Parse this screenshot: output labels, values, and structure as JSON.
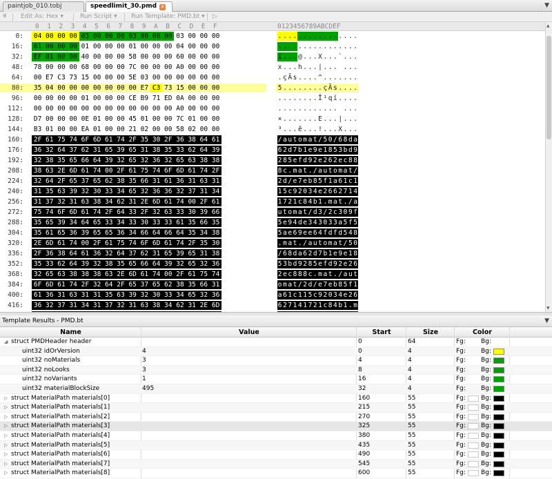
{
  "tabs": [
    {
      "label": "paintjob_010.tobj",
      "active": false
    },
    {
      "label": "speedlimit_30.pmd",
      "active": true
    }
  ],
  "tab_menu": "▼",
  "toolbar": {
    "edit_as": "Edit As: Hex ▾",
    "run_script": "Run Script ▾",
    "run_template": "Run Template: PMD.bt ▾",
    "play": "▷"
  },
  "hex_header": {
    "columns": [
      "0",
      "1",
      "2",
      "3",
      "4",
      "5",
      "6",
      "7",
      "8",
      "9",
      "A",
      "B",
      "C",
      "D",
      "E",
      "F"
    ],
    "ascii_ruler": "0123456789ABCDEF"
  },
  "hex_rows": [
    {
      "offset": "0:",
      "bytes": [
        "04",
        "00",
        "00",
        "00",
        "03",
        "00",
        "00",
        "00",
        "03",
        "00",
        "00",
        "00",
        "03",
        "00",
        "00",
        "00"
      ],
      "ascii": "................"
    },
    {
      "offset": "16:",
      "bytes": [
        "01",
        "00",
        "00",
        "00",
        "01",
        "00",
        "00",
        "00",
        "01",
        "00",
        "00",
        "00",
        "04",
        "00",
        "00",
        "00"
      ],
      "ascii": "................"
    },
    {
      "offset": "32:",
      "bytes": [
        "EF",
        "01",
        "00",
        "00",
        "40",
        "00",
        "00",
        "00",
        "58",
        "00",
        "00",
        "00",
        "60",
        "00",
        "00",
        "00"
      ],
      "ascii": "ï...@...X...`..."
    },
    {
      "offset": "48:",
      "bytes": [
        "78",
        "00",
        "00",
        "00",
        "68",
        "00",
        "00",
        "00",
        "7C",
        "00",
        "00",
        "00",
        "A0",
        "00",
        "00",
        "00"
      ],
      "ascii": "x...h...|... ..."
    },
    {
      "offset": "64:",
      "bytes": [
        "00",
        "E7",
        "C3",
        "73",
        "15",
        "00",
        "00",
        "00",
        "5E",
        "03",
        "00",
        "00",
        "00",
        "00",
        "00",
        "00"
      ],
      "ascii": ".çÃs....^......."
    },
    {
      "offset": "80:",
      "bytes": [
        "35",
        "04",
        "00",
        "00",
        "00",
        "00",
        "00",
        "00",
        "00",
        "E7",
        "C3",
        "73",
        "15",
        "00",
        "00",
        "00"
      ],
      "ascii": "5........çÃs...."
    },
    {
      "offset": "96:",
      "bytes": [
        "00",
        "00",
        "00",
        "00",
        "01",
        "00",
        "00",
        "00",
        "CE",
        "B9",
        "71",
        "ED",
        "0A",
        "00",
        "00",
        "00"
      ],
      "ascii": "........Î¹qí...."
    },
    {
      "offset": "112:",
      "bytes": [
        "00",
        "00",
        "00",
        "00",
        "00",
        "00",
        "00",
        "00",
        "00",
        "00",
        "00",
        "00",
        "A0",
        "00",
        "00",
        "00"
      ],
      "ascii": "............ ..."
    },
    {
      "offset": "128:",
      "bytes": [
        "D7",
        "00",
        "00",
        "00",
        "0E",
        "01",
        "00",
        "00",
        "45",
        "01",
        "00",
        "00",
        "7C",
        "01",
        "00",
        "00"
      ],
      "ascii": "×.......E...|..."
    },
    {
      "offset": "144:",
      "bytes": [
        "B3",
        "01",
        "00",
        "00",
        "EA",
        "01",
        "00",
        "00",
        "21",
        "02",
        "00",
        "00",
        "58",
        "02",
        "00",
        "00"
      ],
      "ascii": "³...ê...!...X..."
    },
    {
      "offset": "160:",
      "bytes": [
        "2F",
        "61",
        "75",
        "74",
        "6F",
        "6D",
        "61",
        "74",
        "2F",
        "35",
        "30",
        "2F",
        "36",
        "38",
        "64",
        "61"
      ],
      "ascii": "/automat/50/68da"
    },
    {
      "offset": "176:",
      "bytes": [
        "36",
        "32",
        "64",
        "37",
        "62",
        "31",
        "65",
        "39",
        "65",
        "31",
        "38",
        "35",
        "33",
        "62",
        "64",
        "39"
      ],
      "ascii": "62d7b1e9e1853bd9"
    },
    {
      "offset": "192:",
      "bytes": [
        "32",
        "38",
        "35",
        "65",
        "66",
        "64",
        "39",
        "32",
        "65",
        "32",
        "36",
        "32",
        "65",
        "63",
        "38",
        "38"
      ],
      "ascii": "285efd92e262ec88"
    },
    {
      "offset": "208:",
      "bytes": [
        "38",
        "63",
        "2E",
        "6D",
        "61",
        "74",
        "00",
        "2F",
        "61",
        "75",
        "74",
        "6F",
        "6D",
        "61",
        "74",
        "2F"
      ],
      "ascii": "8c.mat./automat/"
    },
    {
      "offset": "224:",
      "bytes": [
        "32",
        "64",
        "2F",
        "65",
        "37",
        "65",
        "62",
        "38",
        "35",
        "66",
        "31",
        "61",
        "36",
        "31",
        "63",
        "31"
      ],
      "ascii": "2d/e7eb85f1a61c1"
    },
    {
      "offset": "240:",
      "bytes": [
        "31",
        "35",
        "63",
        "39",
        "32",
        "30",
        "33",
        "34",
        "65",
        "32",
        "36",
        "36",
        "32",
        "37",
        "31",
        "34"
      ],
      "ascii": "15c92034e2662714"
    },
    {
      "offset": "256:",
      "bytes": [
        "31",
        "37",
        "32",
        "31",
        "63",
        "38",
        "34",
        "62",
        "31",
        "2E",
        "6D",
        "61",
        "74",
        "00",
        "2F",
        "61"
      ],
      "ascii": "1721c84b1.mat./a"
    },
    {
      "offset": "272:",
      "bytes": [
        "75",
        "74",
        "6F",
        "6D",
        "61",
        "74",
        "2F",
        "64",
        "33",
        "2F",
        "32",
        "63",
        "33",
        "30",
        "39",
        "66"
      ],
      "ascii": "utomat/d3/2c309f"
    },
    {
      "offset": "288:",
      "bytes": [
        "35",
        "65",
        "39",
        "34",
        "64",
        "65",
        "33",
        "34",
        "33",
        "30",
        "33",
        "33",
        "61",
        "35",
        "66",
        "35"
      ],
      "ascii": "5e94de343033a5f5"
    },
    {
      "offset": "304:",
      "bytes": [
        "35",
        "61",
        "65",
        "36",
        "39",
        "65",
        "65",
        "36",
        "34",
        "66",
        "64",
        "66",
        "64",
        "35",
        "34",
        "38"
      ],
      "ascii": "5ae69ee64fdfd548"
    },
    {
      "offset": "320:",
      "bytes": [
        "2E",
        "6D",
        "61",
        "74",
        "00",
        "2F",
        "61",
        "75",
        "74",
        "6F",
        "6D",
        "61",
        "74",
        "2F",
        "35",
        "30"
      ],
      "ascii": ".mat./automat/50"
    },
    {
      "offset": "336:",
      "bytes": [
        "2F",
        "36",
        "38",
        "64",
        "61",
        "36",
        "32",
        "64",
        "37",
        "62",
        "31",
        "65",
        "39",
        "65",
        "31",
        "38"
      ],
      "ascii": "/68da62d7b1e9e18"
    },
    {
      "offset": "352:",
      "bytes": [
        "35",
        "33",
        "62",
        "64",
        "39",
        "32",
        "38",
        "35",
        "65",
        "66",
        "64",
        "39",
        "32",
        "65",
        "32",
        "36"
      ],
      "ascii": "53bd9285efd92e26"
    },
    {
      "offset": "368:",
      "bytes": [
        "32",
        "65",
        "63",
        "38",
        "38",
        "38",
        "63",
        "2E",
        "6D",
        "61",
        "74",
        "00",
        "2F",
        "61",
        "75",
        "74"
      ],
      "ascii": "2ec888c.mat./aut"
    },
    {
      "offset": "384:",
      "bytes": [
        "6F",
        "6D",
        "61",
        "74",
        "2F",
        "32",
        "64",
        "2F",
        "65",
        "37",
        "65",
        "62",
        "38",
        "35",
        "66",
        "31"
      ],
      "ascii": "omat/2d/e7eb85f1"
    },
    {
      "offset": "400:",
      "bytes": [
        "61",
        "36",
        "31",
        "63",
        "31",
        "31",
        "35",
        "63",
        "39",
        "32",
        "30",
        "33",
        "34",
        "65",
        "32",
        "36"
      ],
      "ascii": "a61c115c92034e26"
    },
    {
      "offset": "416:",
      "bytes": [
        "36",
        "32",
        "37",
        "31",
        "34",
        "31",
        "37",
        "32",
        "31",
        "63",
        "38",
        "34",
        "62",
        "31",
        "2E",
        "6D"
      ],
      "ascii": "627141721c84b1.m"
    },
    {
      "offset": "432:",
      "bytes": [
        "61",
        "74",
        "00",
        "2F",
        "61",
        "75",
        "74",
        "6F",
        "6D",
        "61",
        "74",
        "2F",
        "64",
        "33",
        "2F",
        "32"
      ],
      "ascii": "at./automat/d3/2"
    }
  ],
  "colors": {
    "yellow": "#ffff00",
    "green": "#00a000",
    "black": "#000000",
    "row_highlight": "#ffff99"
  },
  "template_results": {
    "title": "Template Results - PMD.bt",
    "close": "▼",
    "columns": {
      "name": "Name",
      "value": "Value",
      "start": "Start",
      "size": "Size",
      "color": "Color"
    },
    "rows": [
      {
        "name": "struct PMDHeader header",
        "value": "",
        "start": "0",
        "size": "64",
        "fg": "Fg:",
        "bg": "Bg:",
        "swatch": "",
        "expanded": true,
        "indent": 0
      },
      {
        "name": "uint32 idOrVersion",
        "value": "4",
        "start": "0",
        "size": "4",
        "fg": "Fg:",
        "bg": "Bg:",
        "swatch": "#ffff00",
        "indent": 1
      },
      {
        "name": "uint32 noMaterials",
        "value": "3",
        "start": "4",
        "size": "4",
        "fg": "Fg:",
        "bg": "Bg:",
        "swatch": "#00a000",
        "indent": 1
      },
      {
        "name": "uint32 noLooks",
        "value": "3",
        "start": "8",
        "size": "4",
        "fg": "Fg:",
        "bg": "Bg:",
        "swatch": "#00a000",
        "indent": 1
      },
      {
        "name": "uint32 noVariants",
        "value": "1",
        "start": "16",
        "size": "4",
        "fg": "Fg:",
        "bg": "Bg:",
        "swatch": "#00a000",
        "indent": 1
      },
      {
        "name": "uint32 materialBlockSize",
        "value": "495",
        "start": "32",
        "size": "4",
        "fg": "Fg:",
        "bg": "Bg:",
        "swatch": "#00a000",
        "indent": 1
      },
      {
        "name": "struct MaterialPath materials[0]",
        "value": "",
        "start": "160",
        "size": "55",
        "fg": "Fg:",
        "bg": "Bg:",
        "swatch": "#000000",
        "indent": 0
      },
      {
        "name": "struct MaterialPath materials[1]",
        "value": "",
        "start": "215",
        "size": "55",
        "fg": "Fg:",
        "bg": "Bg:",
        "swatch": "#000000",
        "indent": 0
      },
      {
        "name": "struct MaterialPath materials[2]",
        "value": "",
        "start": "270",
        "size": "55",
        "fg": "Fg:",
        "bg": "Bg:",
        "swatch": "#000000",
        "indent": 0
      },
      {
        "name": "struct MaterialPath materials[3]",
        "value": "",
        "start": "325",
        "size": "55",
        "fg": "Fg:",
        "bg": "Bg:",
        "swatch": "#000000",
        "indent": 0
      },
      {
        "name": "struct MaterialPath materials[4]",
        "value": "",
        "start": "380",
        "size": "55",
        "fg": "Fg:",
        "bg": "Bg:",
        "swatch": "#000000",
        "indent": 0
      },
      {
        "name": "struct MaterialPath materials[5]",
        "value": "",
        "start": "435",
        "size": "55",
        "fg": "Fg:",
        "bg": "Bg:",
        "swatch": "#000000",
        "indent": 0
      },
      {
        "name": "struct MaterialPath materials[6]",
        "value": "",
        "start": "490",
        "size": "55",
        "fg": "Fg:",
        "bg": "Bg:",
        "swatch": "#000000",
        "indent": 0
      },
      {
        "name": "struct MaterialPath materials[7]",
        "value": "",
        "start": "545",
        "size": "55",
        "fg": "Fg:",
        "bg": "Bg:",
        "swatch": "#000000",
        "indent": 0
      },
      {
        "name": "struct MaterialPath materials[8]",
        "value": "",
        "start": "600",
        "size": "55",
        "fg": "Fg:",
        "bg": "Bg:",
        "swatch": "#000000",
        "indent": 0
      }
    ]
  }
}
